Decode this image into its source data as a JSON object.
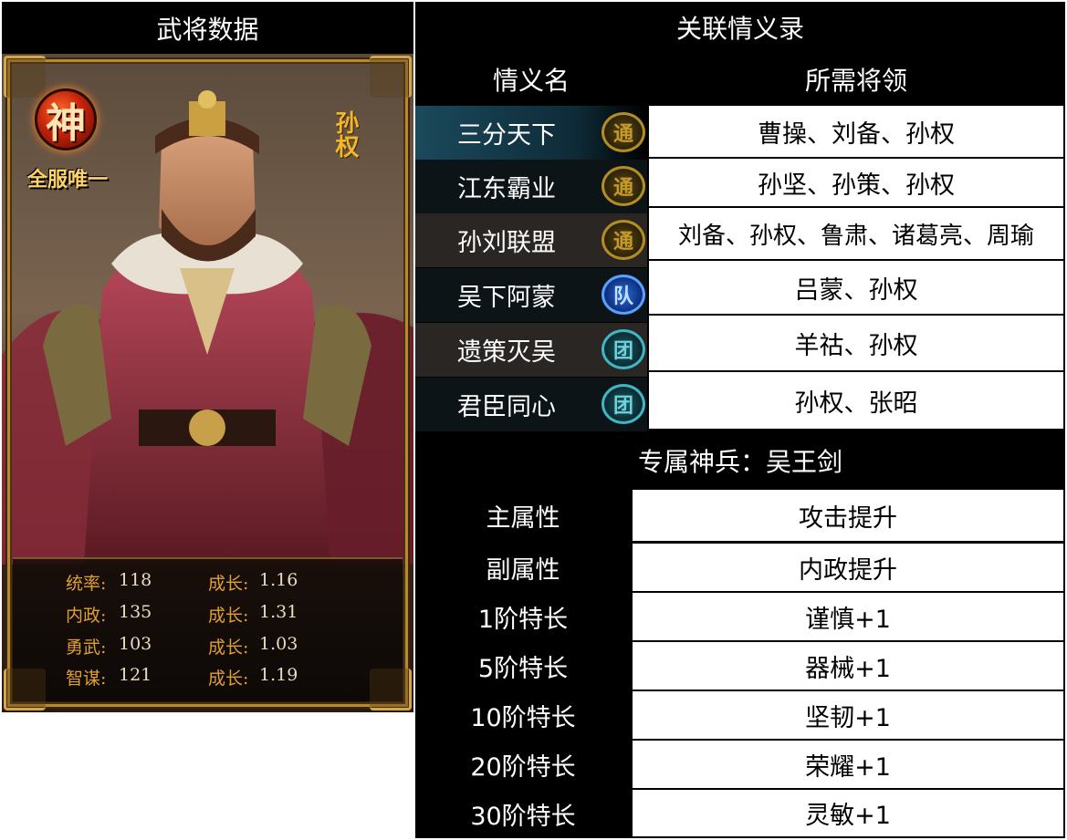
{
  "left_header": "武将数据",
  "card": {
    "badge_text": "神",
    "unique_label": "全服唯一",
    "name": "孙权",
    "stats": [
      {
        "name": "统率:",
        "value": "118",
        "growth_label": "成长:",
        "growth": "1.16"
      },
      {
        "name": "内政:",
        "value": "135",
        "growth_label": "成长:",
        "growth": "1.31"
      },
      {
        "name": "勇武:",
        "value": "103",
        "growth_label": "成长:",
        "growth": "1.03"
      },
      {
        "name": "智谋:",
        "value": "121",
        "growth_label": "成长:",
        "growth": "1.19"
      }
    ]
  },
  "bonds": {
    "title": "关联情义录",
    "col_name": "情义名",
    "col_generals": "所需将领",
    "rows": [
      {
        "name": "三分天下",
        "icon": "通",
        "icon_type": "gold",
        "generals": "曹操、刘备、孙权"
      },
      {
        "name": "江东霸业",
        "icon": "通",
        "icon_type": "gold",
        "generals": "孙坚、孙策、孙权"
      },
      {
        "name": "孙刘联盟",
        "icon": "通",
        "icon_type": "gold",
        "generals": "刘备、孙权、鲁肃、诸葛亮、周瑜"
      },
      {
        "name": "吴下阿蒙",
        "icon": "队",
        "icon_type": "blue",
        "generals": "吕蒙、孙权"
      },
      {
        "name": "遗策灭吴",
        "icon": "团",
        "icon_type": "teal",
        "generals": "羊祜、孙权"
      },
      {
        "name": "君臣同心",
        "icon": "团",
        "icon_type": "teal",
        "generals": "孙权、张昭"
      }
    ]
  },
  "weapon": {
    "title": "专属神兵：吴王剑",
    "rows": [
      {
        "label": "主属性",
        "value": "攻击提升"
      },
      {
        "label": "副属性",
        "value": "内政提升"
      },
      {
        "label": "1阶特长",
        "value": "谨慎+1"
      },
      {
        "label": "5阶特长",
        "value": "器械+1"
      },
      {
        "label": "10阶特长",
        "value": "坚韧+1"
      },
      {
        "label": "20阶特长",
        "value": "荣耀+1"
      },
      {
        "label": "30阶特长",
        "value": "灵敏+1"
      }
    ]
  }
}
